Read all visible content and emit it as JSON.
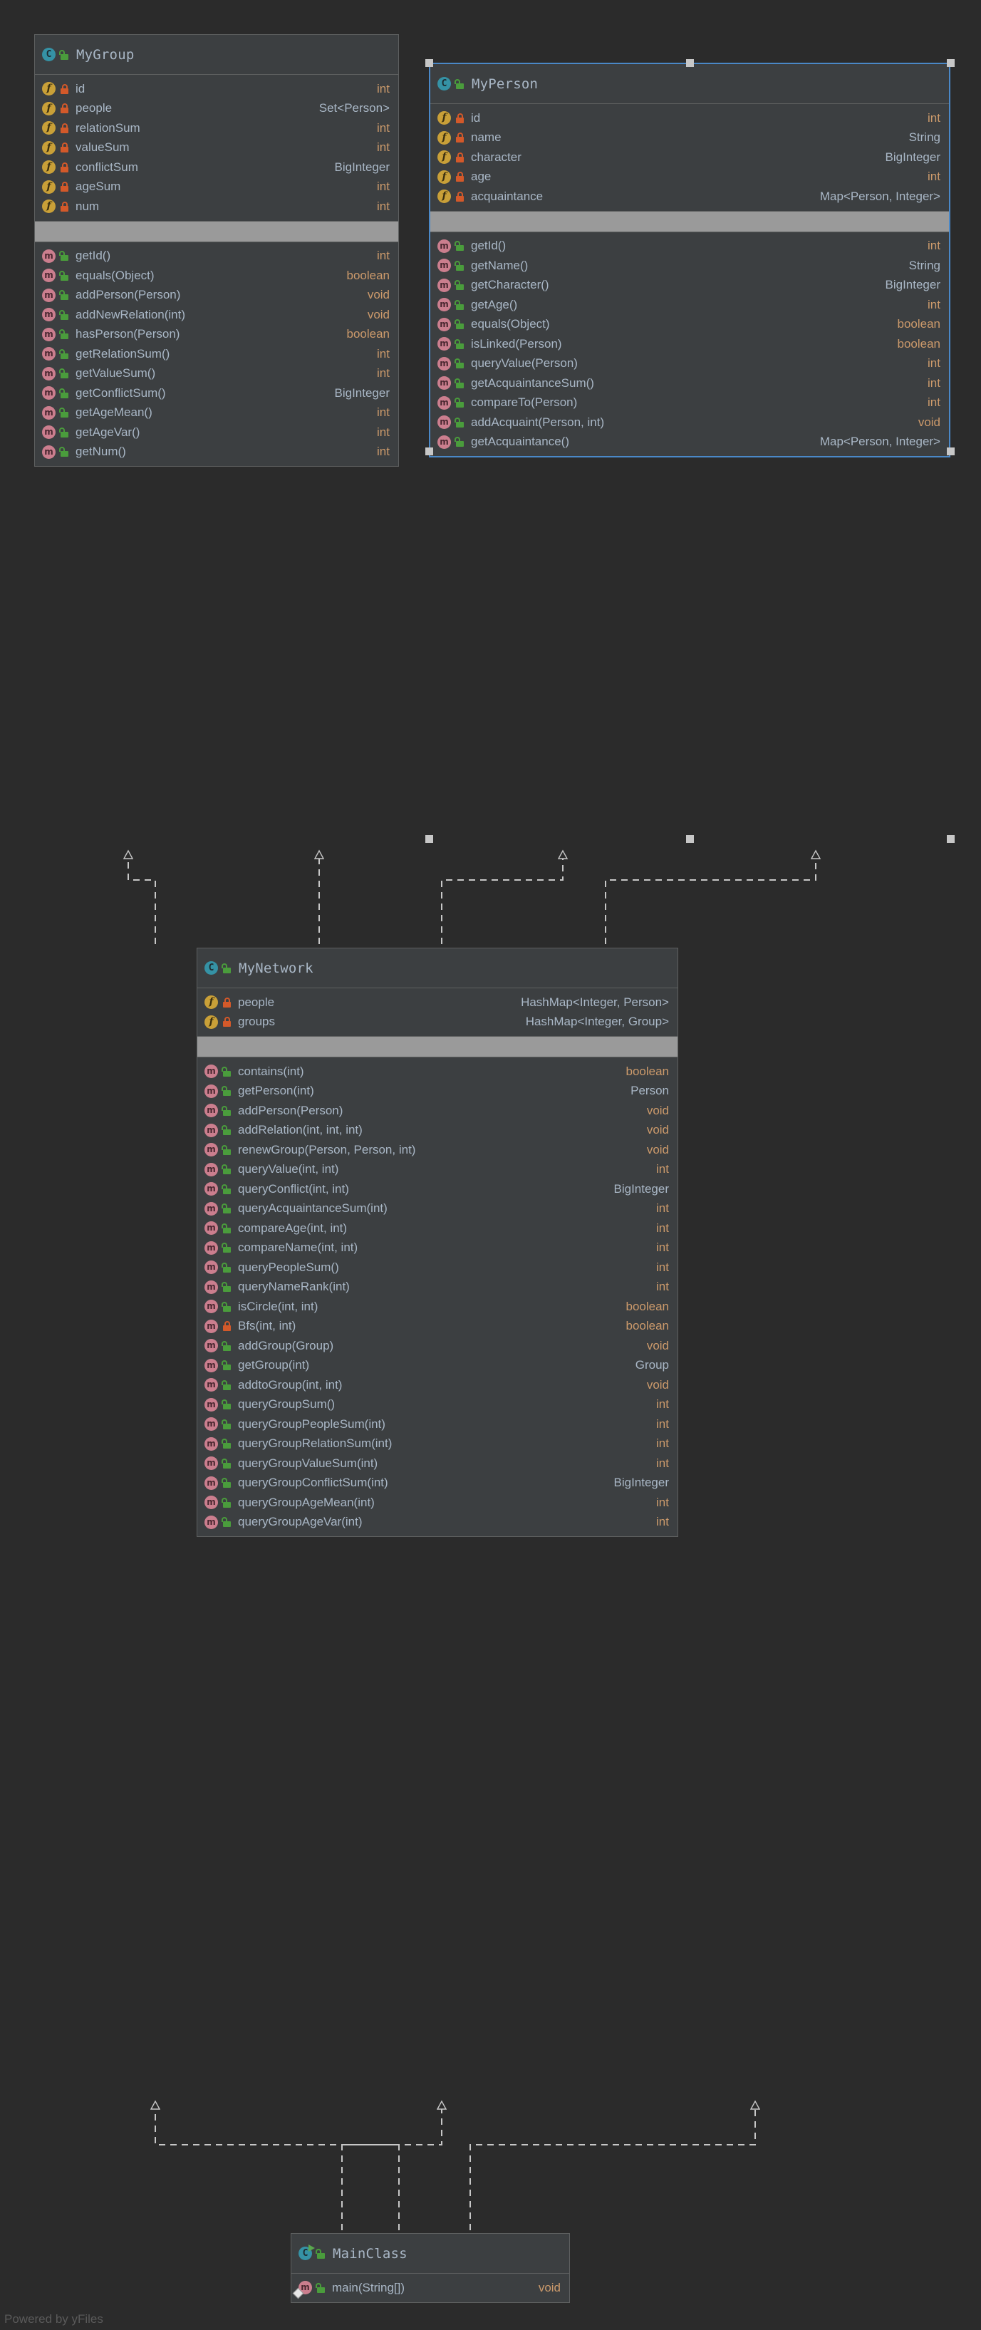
{
  "watermark": "Powered by yFiles",
  "icons": {
    "class": "class-icon",
    "field": "field-icon",
    "method": "method-icon",
    "lock_public": "unlocked-padlock-icon",
    "lock_private": "locked-padlock-icon",
    "runnable": "run-arrow-icon"
  },
  "colors": {
    "background": "#2b2b2b",
    "node_bg": "#3c3f41",
    "node_border": "#5e6060",
    "selection_border": "#4a88c7",
    "separator_band": "#9a9a9a",
    "text": "#a9b7c6",
    "primitive_type": "#cc9a6b",
    "class_icon": "#3592a5",
    "field_icon": "#c9a038",
    "method_icon": "#cb7e8e",
    "lock_private": "#d3592a",
    "lock_public": "#4a9c3c",
    "watermark": "#5a5a5a"
  },
  "classes": [
    {
      "id": "MyGroup",
      "name": "MyGroup",
      "visibility": "public",
      "selected": false,
      "runnable": false,
      "fields": [
        {
          "name": "id",
          "type": "int",
          "visibility": "private",
          "primitive": true
        },
        {
          "name": "people",
          "type": "Set<Person>",
          "visibility": "private",
          "primitive": false
        },
        {
          "name": "relationSum",
          "type": "int",
          "visibility": "private",
          "primitive": true
        },
        {
          "name": "valueSum",
          "type": "int",
          "visibility": "private",
          "primitive": true
        },
        {
          "name": "conflictSum",
          "type": "BigInteger",
          "visibility": "private",
          "primitive": false
        },
        {
          "name": "ageSum",
          "type": "int",
          "visibility": "private",
          "primitive": true
        },
        {
          "name": "num",
          "type": "int",
          "visibility": "private",
          "primitive": true
        }
      ],
      "methods": [
        {
          "name": "getId()",
          "type": "int",
          "visibility": "public",
          "primitive": true
        },
        {
          "name": "equals(Object)",
          "type": "boolean",
          "visibility": "public",
          "primitive": true
        },
        {
          "name": "addPerson(Person)",
          "type": "void",
          "visibility": "public",
          "primitive": true
        },
        {
          "name": "addNewRelation(int)",
          "type": "void",
          "visibility": "public",
          "primitive": true
        },
        {
          "name": "hasPerson(Person)",
          "type": "boolean",
          "visibility": "public",
          "primitive": true
        },
        {
          "name": "getRelationSum()",
          "type": "int",
          "visibility": "public",
          "primitive": true
        },
        {
          "name": "getValueSum()",
          "type": "int",
          "visibility": "public",
          "primitive": true
        },
        {
          "name": "getConflictSum()",
          "type": "BigInteger",
          "visibility": "public",
          "primitive": false
        },
        {
          "name": "getAgeMean()",
          "type": "int",
          "visibility": "public",
          "primitive": true
        },
        {
          "name": "getAgeVar()",
          "type": "int",
          "visibility": "public",
          "primitive": true
        },
        {
          "name": "getNum()",
          "type": "int",
          "visibility": "public",
          "primitive": true
        }
      ]
    },
    {
      "id": "MyPerson",
      "name": "MyPerson",
      "visibility": "public",
      "selected": true,
      "runnable": false,
      "fields": [
        {
          "name": "id",
          "type": "int",
          "visibility": "private",
          "primitive": true
        },
        {
          "name": "name",
          "type": "String",
          "visibility": "private",
          "primitive": false
        },
        {
          "name": "character",
          "type": "BigInteger",
          "visibility": "private",
          "primitive": false
        },
        {
          "name": "age",
          "type": "int",
          "visibility": "private",
          "primitive": true
        },
        {
          "name": "acquaintance",
          "type": "Map<Person, Integer>",
          "visibility": "private",
          "primitive": false
        }
      ],
      "methods": [
        {
          "name": "getId()",
          "type": "int",
          "visibility": "public",
          "primitive": true
        },
        {
          "name": "getName()",
          "type": "String",
          "visibility": "public",
          "primitive": false
        },
        {
          "name": "getCharacter()",
          "type": "BigInteger",
          "visibility": "public",
          "primitive": false
        },
        {
          "name": "getAge()",
          "type": "int",
          "visibility": "public",
          "primitive": true
        },
        {
          "name": "equals(Object)",
          "type": "boolean",
          "visibility": "public",
          "primitive": true
        },
        {
          "name": "isLinked(Person)",
          "type": "boolean",
          "visibility": "public",
          "primitive": true
        },
        {
          "name": "queryValue(Person)",
          "type": "int",
          "visibility": "public",
          "primitive": true
        },
        {
          "name": "getAcquaintanceSum()",
          "type": "int",
          "visibility": "public",
          "primitive": true
        },
        {
          "name": "compareTo(Person)",
          "type": "int",
          "visibility": "public",
          "primitive": true
        },
        {
          "name": "addAcquaint(Person, int)",
          "type": "void",
          "visibility": "public",
          "primitive": true
        },
        {
          "name": "getAcquaintance()",
          "type": "Map<Person, Integer>",
          "visibility": "public",
          "primitive": false
        }
      ]
    },
    {
      "id": "MyNetwork",
      "name": "MyNetwork",
      "visibility": "public",
      "selected": false,
      "runnable": false,
      "fields": [
        {
          "name": "people",
          "type": "HashMap<Integer, Person>",
          "visibility": "private",
          "primitive": false
        },
        {
          "name": "groups",
          "type": "HashMap<Integer, Group>",
          "visibility": "private",
          "primitive": false
        }
      ],
      "methods": [
        {
          "name": "contains(int)",
          "type": "boolean",
          "visibility": "public",
          "primitive": true
        },
        {
          "name": "getPerson(int)",
          "type": "Person",
          "visibility": "public",
          "primitive": false
        },
        {
          "name": "addPerson(Person)",
          "type": "void",
          "visibility": "public",
          "primitive": true
        },
        {
          "name": "addRelation(int, int, int)",
          "type": "void",
          "visibility": "public",
          "primitive": true
        },
        {
          "name": "renewGroup(Person, Person, int)",
          "type": "void",
          "visibility": "public",
          "primitive": true
        },
        {
          "name": "queryValue(int, int)",
          "type": "int",
          "visibility": "public",
          "primitive": true
        },
        {
          "name": "queryConflict(int, int)",
          "type": "BigInteger",
          "visibility": "public",
          "primitive": false
        },
        {
          "name": "queryAcquaintanceSum(int)",
          "type": "int",
          "visibility": "public",
          "primitive": true
        },
        {
          "name": "compareAge(int, int)",
          "type": "int",
          "visibility": "public",
          "primitive": true
        },
        {
          "name": "compareName(int, int)",
          "type": "int",
          "visibility": "public",
          "primitive": true
        },
        {
          "name": "queryPeopleSum()",
          "type": "int",
          "visibility": "public",
          "primitive": true
        },
        {
          "name": "queryNameRank(int)",
          "type": "int",
          "visibility": "public",
          "primitive": true
        },
        {
          "name": "isCircle(int, int)",
          "type": "boolean",
          "visibility": "public",
          "primitive": true
        },
        {
          "name": "Bfs(int, int)",
          "type": "boolean",
          "visibility": "private",
          "primitive": true
        },
        {
          "name": "addGroup(Group)",
          "type": "void",
          "visibility": "public",
          "primitive": true
        },
        {
          "name": "getGroup(int)",
          "type": "Group",
          "visibility": "public",
          "primitive": false
        },
        {
          "name": "addtoGroup(int, int)",
          "type": "void",
          "visibility": "public",
          "primitive": true
        },
        {
          "name": "queryGroupSum()",
          "type": "int",
          "visibility": "public",
          "primitive": true
        },
        {
          "name": "queryGroupPeopleSum(int)",
          "type": "int",
          "visibility": "public",
          "primitive": true
        },
        {
          "name": "queryGroupRelationSum(int)",
          "type": "int",
          "visibility": "public",
          "primitive": true
        },
        {
          "name": "queryGroupValueSum(int)",
          "type": "int",
          "visibility": "public",
          "primitive": true
        },
        {
          "name": "queryGroupConflictSum(int)",
          "type": "BigInteger",
          "visibility": "public",
          "primitive": false
        },
        {
          "name": "queryGroupAgeMean(int)",
          "type": "int",
          "visibility": "public",
          "primitive": true
        },
        {
          "name": "queryGroupAgeVar(int)",
          "type": "int",
          "visibility": "public",
          "primitive": true
        }
      ]
    },
    {
      "id": "MainClass",
      "name": "MainClass",
      "visibility": "public",
      "selected": false,
      "runnable": true,
      "fields": [],
      "methods": [
        {
          "name": "main(String[])",
          "type": "void",
          "visibility": "public",
          "primitive": true,
          "marker": "diamond"
        }
      ]
    }
  ]
}
